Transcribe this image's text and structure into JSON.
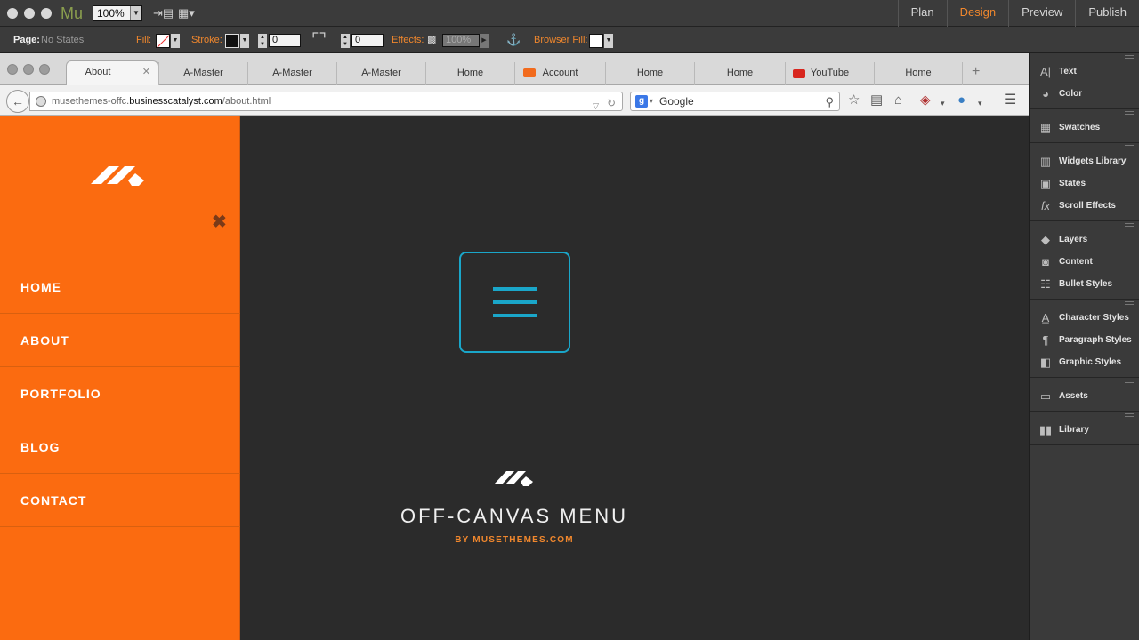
{
  "app": {
    "logo": "Mu",
    "zoom": "100%",
    "modes": [
      {
        "label": "Plan"
      },
      {
        "label": "Design"
      },
      {
        "label": "Preview"
      },
      {
        "label": "Publish"
      }
    ],
    "active_mode": "Design",
    "accent_color": "#f0872d"
  },
  "control_bar": {
    "page_label": "Page:",
    "page_value": "No States",
    "fill_label": "Fill:",
    "stroke_label": "Stroke:",
    "stroke_value": "0",
    "corner_value": "0",
    "effects_label": "Effects:",
    "opacity_value": "100%",
    "browser_fill_label": "Browser Fill:"
  },
  "browser": {
    "tabs": [
      {
        "label": "About",
        "active": true
      },
      {
        "label": "A-Master"
      },
      {
        "label": "A-Master"
      },
      {
        "label": "A-Master"
      },
      {
        "label": "Home"
      },
      {
        "label": "Account",
        "icon": "musethemes-icon"
      },
      {
        "label": "Home"
      },
      {
        "label": "Home"
      },
      {
        "label": "YouTube",
        "icon": "youtube-icon"
      },
      {
        "label": "Home"
      }
    ],
    "url_prefix": "musethemes-offc.",
    "url_host": "businesscatalyst.com",
    "url_path": "/about.html",
    "search_engine": "Google"
  },
  "offcanvas": {
    "bg_color": "#fb6b10",
    "close_glyph": "✖",
    "menu": [
      {
        "label": "HOME"
      },
      {
        "label": "ABOUT"
      },
      {
        "label": "PORTFOLIO"
      },
      {
        "label": "BLOG"
      },
      {
        "label": "CONTACT"
      }
    ]
  },
  "hero": {
    "title": "OFF-CANVAS MENU",
    "subtitle": "BY MUSETHEMES.COM",
    "button_color": "#1aa6c9"
  },
  "panel": {
    "groups": [
      [
        {
          "label": "Text",
          "icon": "text-icon"
        },
        {
          "label": "Color",
          "icon": "color-icon"
        }
      ],
      [
        {
          "label": "Swatches",
          "icon": "swatches-icon"
        }
      ],
      [
        {
          "label": "Widgets Library",
          "icon": "widgets-icon"
        },
        {
          "label": "States",
          "icon": "states-icon"
        },
        {
          "label": "Scroll Effects",
          "icon": "fx-icon"
        }
      ],
      [
        {
          "label": "Layers",
          "icon": "layers-icon"
        },
        {
          "label": "Content",
          "icon": "content-icon"
        },
        {
          "label": "Bullet Styles",
          "icon": "bullet-styles-icon"
        }
      ],
      [
        {
          "label": "Character Styles",
          "icon": "character-styles-icon"
        },
        {
          "label": "Paragraph Styles",
          "icon": "paragraph-styles-icon"
        },
        {
          "label": "Graphic Styles",
          "icon": "graphic-styles-icon"
        }
      ],
      [
        {
          "label": "Assets",
          "icon": "assets-icon"
        }
      ],
      [
        {
          "label": "Library",
          "icon": "library-icon"
        }
      ]
    ]
  }
}
